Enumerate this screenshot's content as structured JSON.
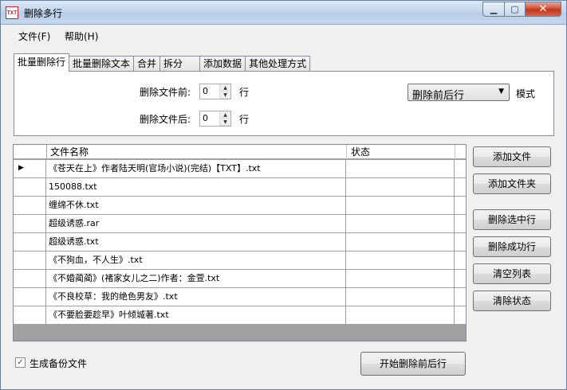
{
  "window": {
    "title": "删除多行",
    "app_icon_text": "TXT",
    "controls": {
      "minimize_icon": "minimize-icon",
      "maximize_icon": "maximize-icon",
      "close_icon": "close-icon"
    }
  },
  "menu": {
    "items": [
      "文件(F)",
      "帮助(H)"
    ]
  },
  "tabs": [
    {
      "label": "批量删除行",
      "active": true
    },
    {
      "label": "批量删除文本",
      "active": false
    },
    {
      "label": "合并",
      "active": false
    },
    {
      "label": "拆分",
      "active": false
    },
    {
      "label": "添加数据",
      "active": false
    },
    {
      "label": "其他处理方式",
      "active": false
    }
  ],
  "options": {
    "before_label": "删除文件前:",
    "before_value": "0",
    "before_unit": "行",
    "after_label": "删除文件后:",
    "after_value": "0",
    "after_unit": "行",
    "mode_selected": "删除前后行",
    "mode_label": "模式"
  },
  "grid": {
    "columns": [
      "文件名称",
      "状态"
    ],
    "rows": [
      {
        "name": "《苍天在上》作者陆天明(官场小说)(完结)【TXT】.txt",
        "status": "",
        "current": true
      },
      {
        "name": "150088.txt",
        "status": "",
        "current": false
      },
      {
        "name": "缠绵不休.txt",
        "status": "",
        "current": false
      },
      {
        "name": "超级诱惑.rar",
        "status": "",
        "current": false
      },
      {
        "name": "超级诱惑.txt",
        "status": "",
        "current": false
      },
      {
        "name": "《不狗血，不人生》.txt",
        "status": "",
        "current": false
      },
      {
        "name": "《不婚蔺蔺》(褚家女儿之二)作者：金萱.txt",
        "status": "",
        "current": false
      },
      {
        "name": "《不良校草：我的绝色男友》.txt",
        "status": "",
        "current": false
      },
      {
        "name": "《不要脸要趁早》叶倾城著.txt",
        "status": "",
        "current": false
      }
    ]
  },
  "buttons": {
    "add_file": "添加文件",
    "add_folder": "添加文件夹",
    "delete_selected": "删除选中行",
    "delete_success": "删除成功行",
    "clear_list": "清空列表",
    "clear_status": "清除状态",
    "start": "开始删除前后行"
  },
  "backup": {
    "label": "生成备份文件",
    "checked": true
  }
}
